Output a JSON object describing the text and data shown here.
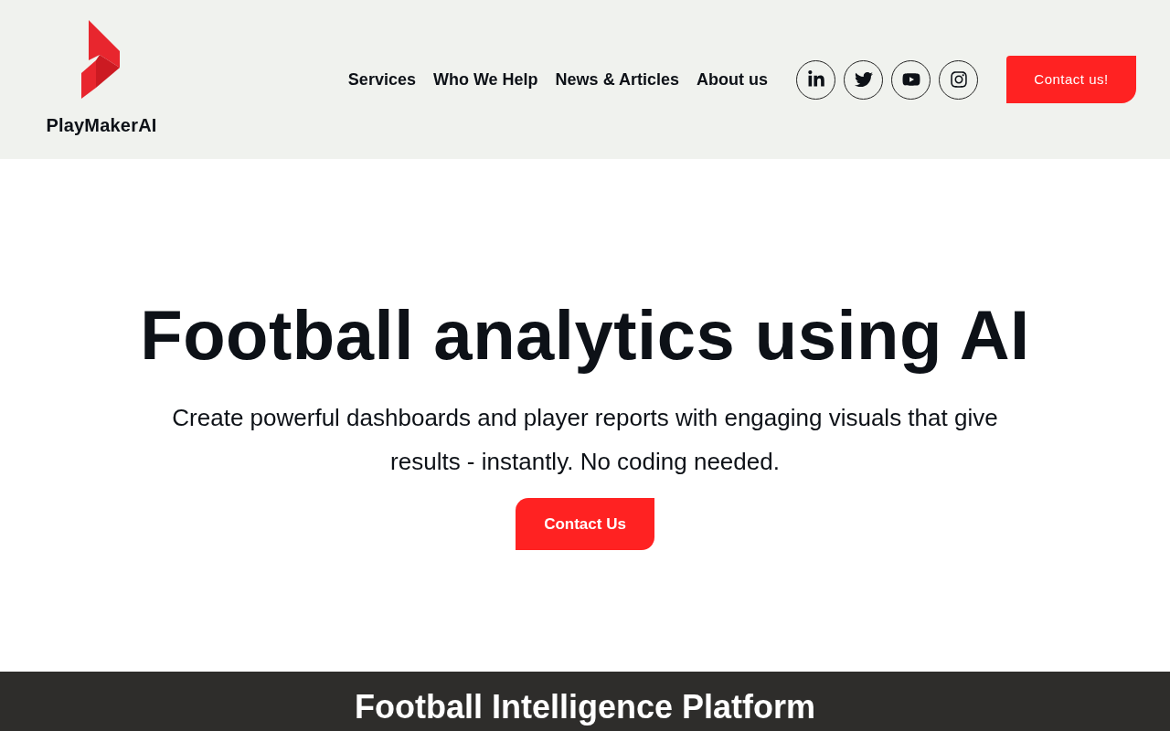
{
  "header": {
    "logo_text": "PlayMakerAI",
    "nav": [
      "Services",
      "Who We Help",
      "News & Articles",
      "About us"
    ],
    "social": [
      {
        "kind": "linkedin"
      },
      {
        "kind": "twitter"
      },
      {
        "kind": "youtube"
      },
      {
        "kind": "instagram"
      }
    ],
    "cta": "Contact us!"
  },
  "hero": {
    "title": "Football analytics using AI",
    "subtitle": "Create powerful dashboards and player reports with engaging visuals that give results - instantly. No coding needed.",
    "button": "Contact Us"
  },
  "next_section": {
    "title": "Football Intelligence Platform"
  }
}
